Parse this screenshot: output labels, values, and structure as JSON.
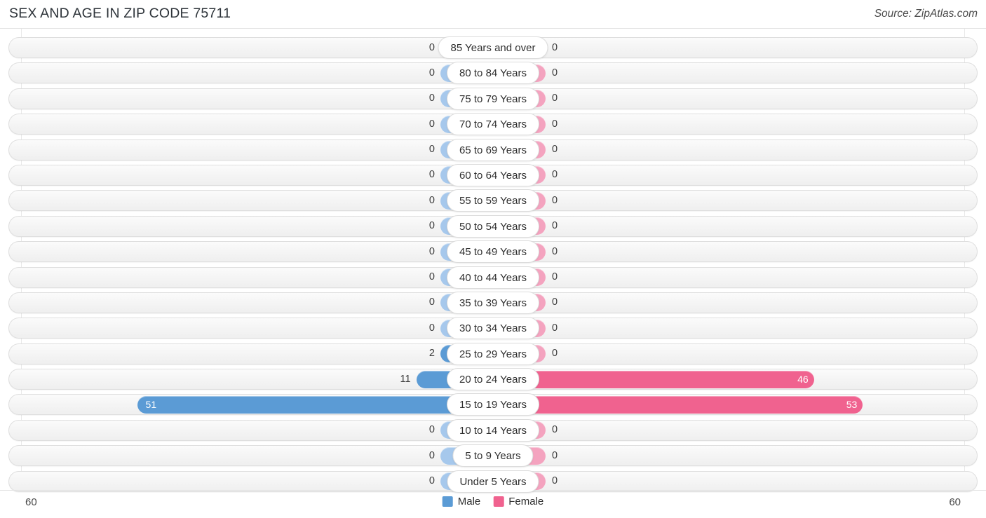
{
  "header": {
    "title": "SEX AND AGE IN ZIP CODE 75711",
    "source": "Source: ZipAtlas.com"
  },
  "axis": {
    "left_max_label": "60",
    "right_max_label": "60"
  },
  "legend": {
    "male_label": "Male",
    "female_label": "Female",
    "male_color": "#5b9bd5",
    "female_color": "#f0628f"
  },
  "colors": {
    "male_strong": "#5b9bd5",
    "male_light": "#a6c8ec",
    "female_strong": "#f0628f",
    "female_light": "#f4a3bf",
    "track": "#f4f4f4",
    "track_border": "#dedede"
  },
  "chart_data": {
    "type": "bar",
    "subtype": "population-pyramid",
    "title": "SEX AND AGE IN ZIP CODE 75711",
    "xlabel": "",
    "ylabel": "",
    "xlim": [
      0,
      60
    ],
    "axis_max": 60,
    "grid": true,
    "legend_position": "bottom-center",
    "categories": [
      "85 Years and over",
      "80 to 84 Years",
      "75 to 79 Years",
      "70 to 74 Years",
      "65 to 69 Years",
      "60 to 64 Years",
      "55 to 59 Years",
      "50 to 54 Years",
      "45 to 49 Years",
      "40 to 44 Years",
      "35 to 39 Years",
      "30 to 34 Years",
      "25 to 29 Years",
      "20 to 24 Years",
      "15 to 19 Years",
      "10 to 14 Years",
      "5 to 9 Years",
      "Under 5 Years"
    ],
    "series": [
      {
        "name": "Male",
        "color": "#5b9bd5",
        "direction": "left",
        "values": [
          0,
          0,
          0,
          0,
          0,
          0,
          0,
          0,
          0,
          0,
          0,
          0,
          2,
          11,
          51,
          0,
          0,
          0
        ]
      },
      {
        "name": "Female",
        "color": "#f0628f",
        "direction": "right",
        "values": [
          0,
          0,
          0,
          0,
          0,
          0,
          0,
          0,
          0,
          0,
          0,
          0,
          0,
          46,
          53,
          0,
          0,
          0
        ]
      }
    ]
  }
}
